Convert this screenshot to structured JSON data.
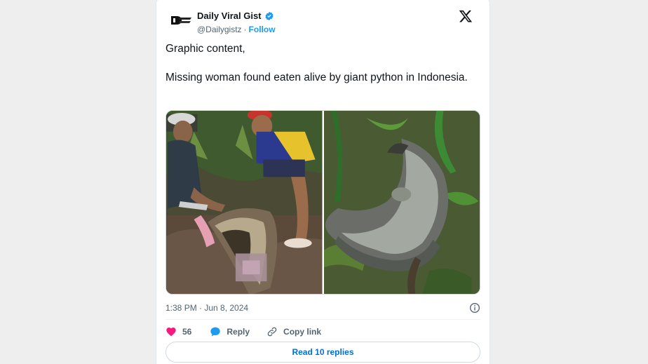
{
  "tweet": {
    "display_name": "Daily Viral Gist",
    "handle": "@Dailygistz",
    "separator": "·",
    "follow_label": "Follow",
    "text_line1": "Graphic content,",
    "text_line2": "Missing woman found eaten alive by giant python in Indonesia.",
    "timestamp": "1:38 PM · Jun 8, 2024",
    "likes_count": "56",
    "reply_label": "Reply",
    "copy_link_label": "Copy link",
    "read_replies_label": "Read 10 replies"
  },
  "icons": {
    "verified": "verified-badge-icon",
    "x_logo": "x-logo-icon",
    "info": "info-icon",
    "like": "heart-icon",
    "reply": "speech-bubble-icon",
    "copy_link": "link-icon"
  },
  "colors": {
    "accent": "#1d9bf0",
    "like": "#f91880",
    "link_text": "#006fd6",
    "muted_text": "#536471"
  }
}
